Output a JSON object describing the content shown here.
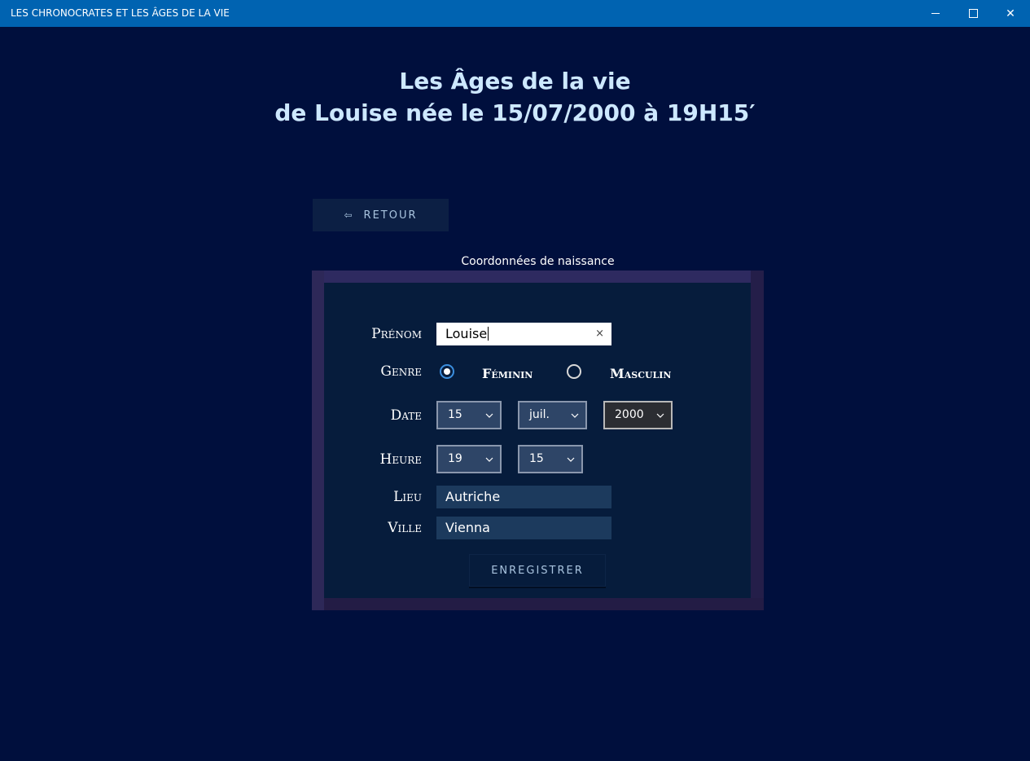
{
  "window": {
    "title": "LES CHRONOCRATES ET LES ÂGES DE LA VIE",
    "minimize_icon": "minimize-icon",
    "maximize_icon": "maximize-icon",
    "close_icon": "close-icon",
    "close_glyph": "✕"
  },
  "header": {
    "line1": "Les Âges de la vie",
    "line2": "de Louise née le 15/07/2000 à 19H15′"
  },
  "back_button": {
    "arrow": "⇦",
    "label": "RETOUR"
  },
  "section_label": "Coordonnées de naissance",
  "form": {
    "prenom_label": "Prénom",
    "prenom_value": "Louise",
    "clear_glyph": "×",
    "genre_label": "Genre",
    "genre_options": [
      {
        "label": "Féminin",
        "selected": true
      },
      {
        "label": "Masculin",
        "selected": false
      }
    ],
    "date_label": "Date",
    "date_day": "15",
    "date_month": "juil.",
    "date_year": "2000",
    "heure_label": "Heure",
    "heure_hour": "19",
    "heure_minute": "15",
    "lieu_label": "Lieu",
    "lieu_value": "Autriche",
    "ville_label": "Ville",
    "ville_value": "Vienna",
    "save_label": "ENREGISTRER"
  },
  "colors": {
    "background": "#000f3d",
    "titlebar": "#0063b1",
    "panel": "#061c3c",
    "frame": "#2b2353",
    "heading": "#cde8ff",
    "radio_accent": "#3b8ede"
  }
}
